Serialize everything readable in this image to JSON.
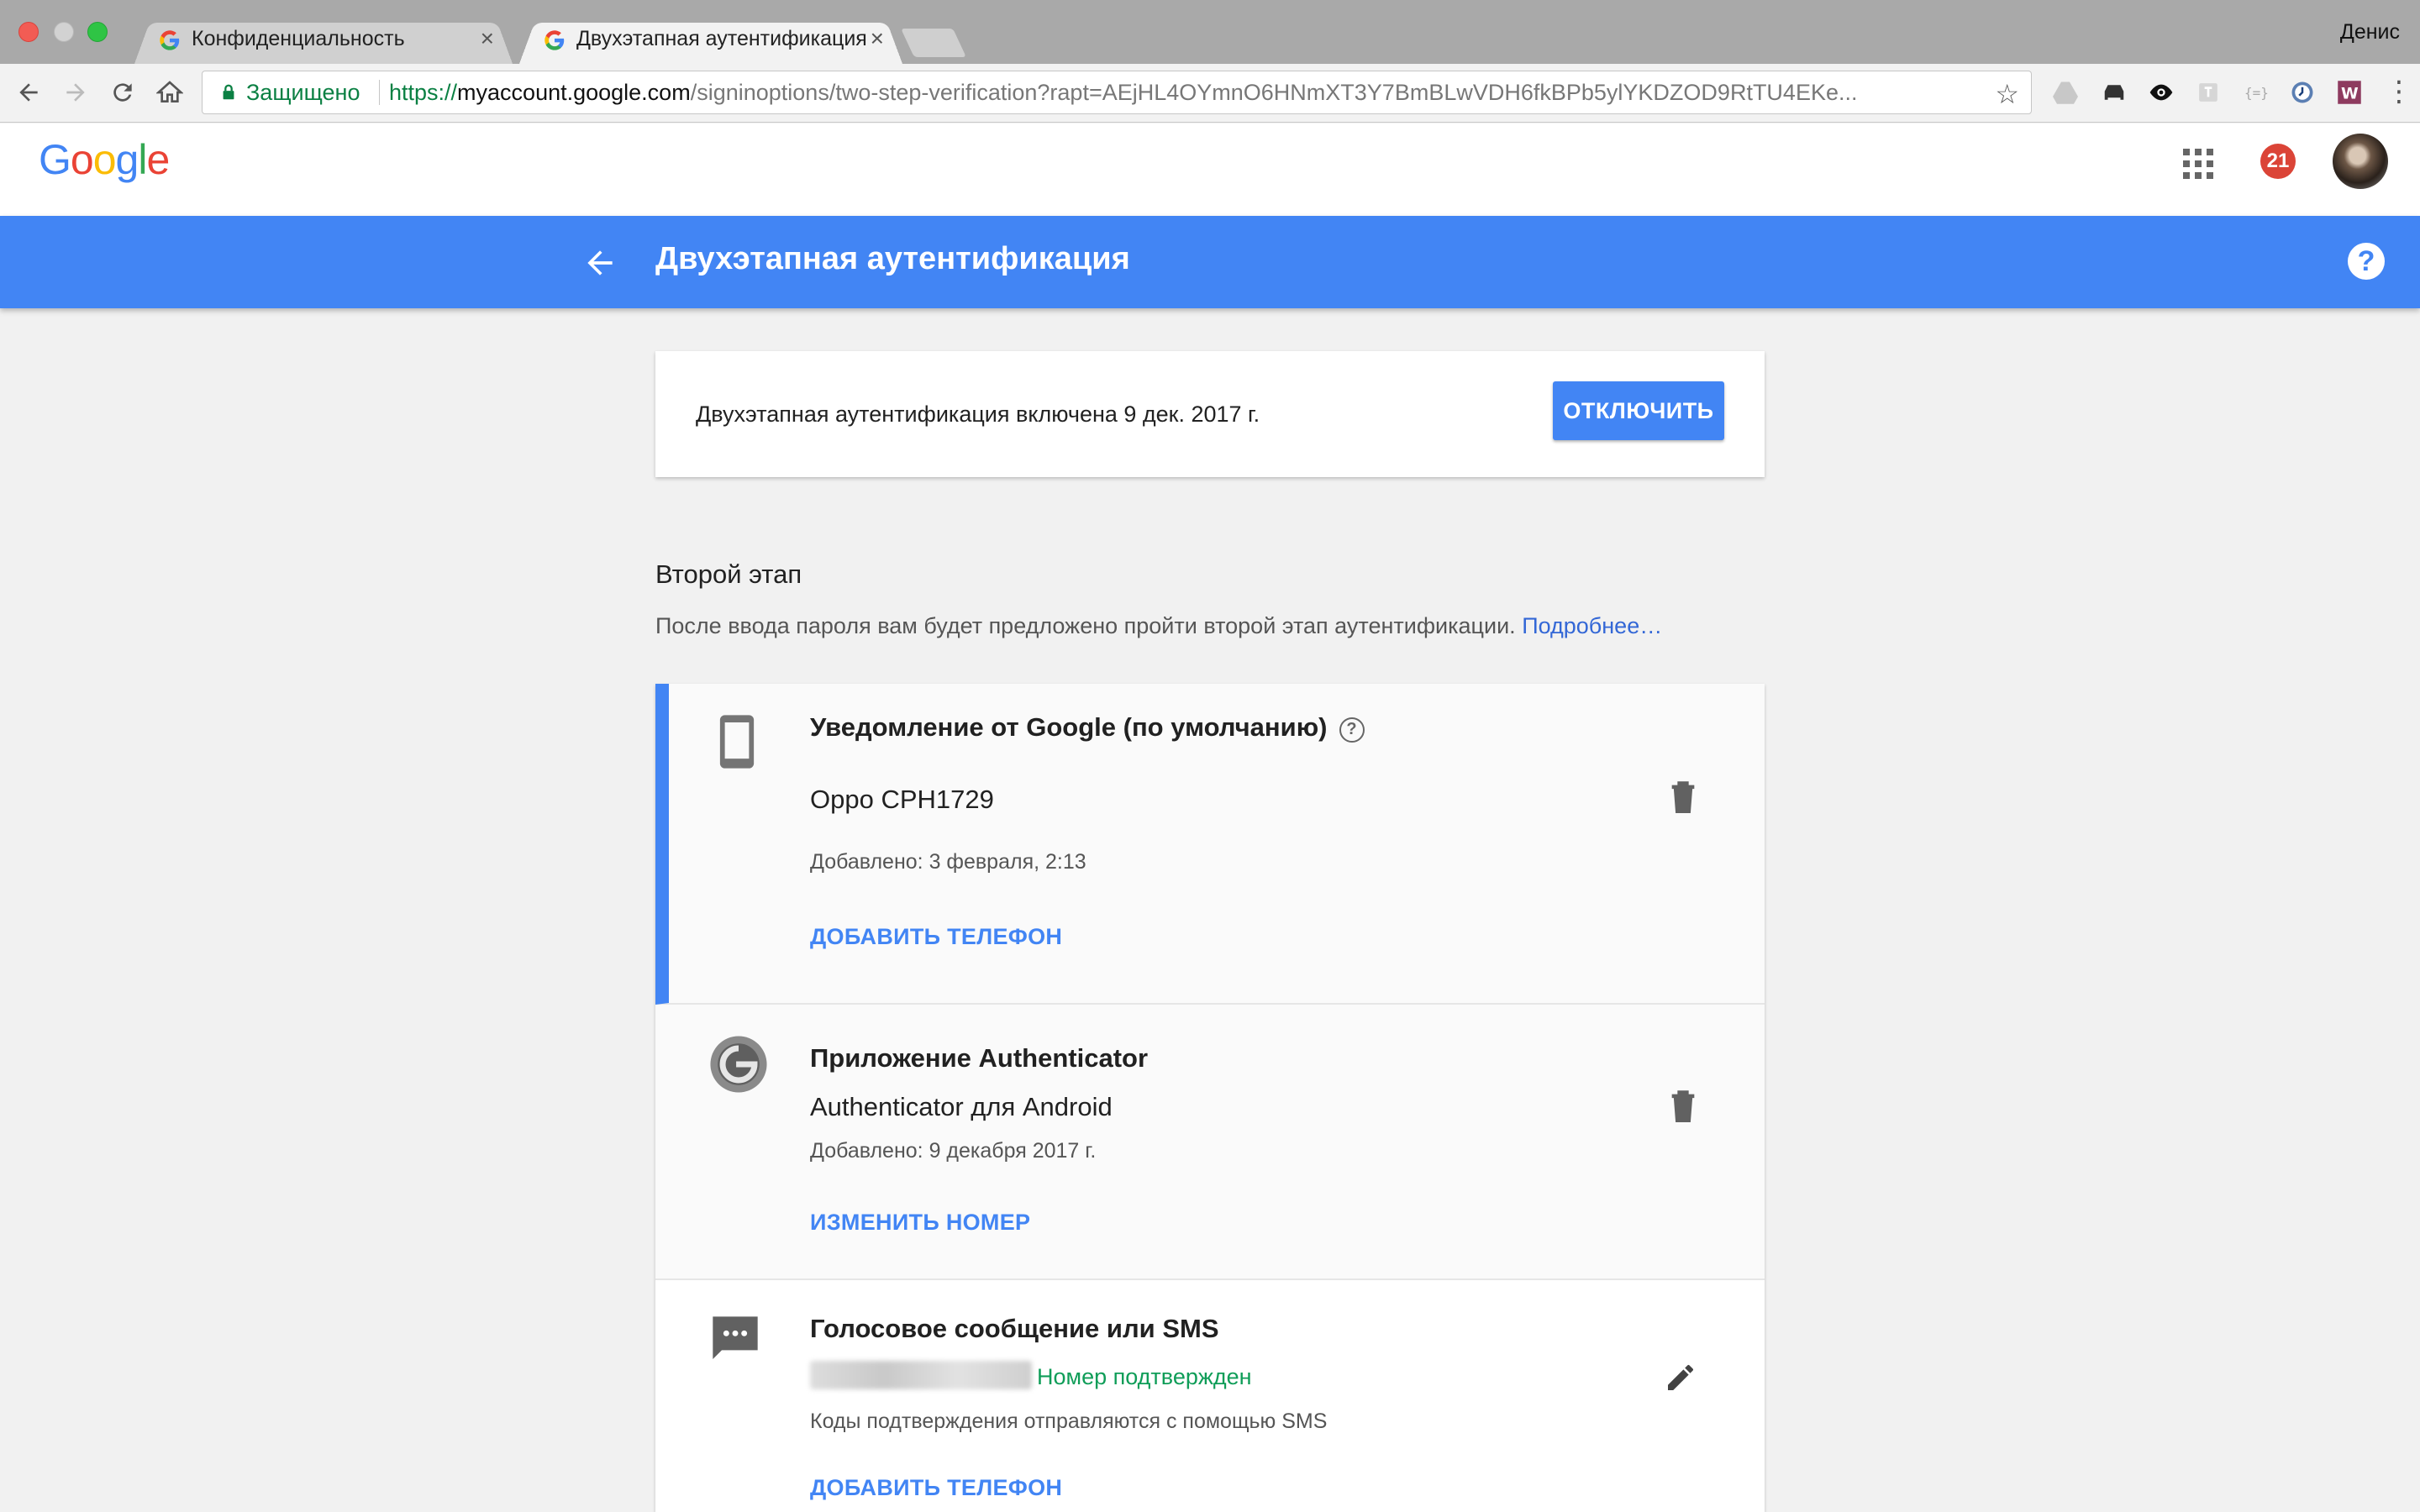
{
  "browser": {
    "tabs": [
      {
        "title": "Конфиденциальность",
        "active": false
      },
      {
        "title": "Двухэтапная аутентификация",
        "active": true
      }
    ],
    "profile_name": "Денис",
    "secure_label": "Защищено",
    "url": {
      "scheme": "https://",
      "host": "myaccount.google.com",
      "path": "/signinoptions/two-step-verification?rapt=AEjHL4OYmnO6HNmXT3Y7BmBLwVDH6fkBPb5ylYKDZOD9RtTU4EKe..."
    },
    "close_glyph": "×",
    "star_glyph": "☆",
    "menu_glyph": "⋮"
  },
  "header": {
    "logo_letters": [
      "G",
      "o",
      "o",
      "g",
      "l",
      "e"
    ],
    "logo_colors": [
      "#4285f4",
      "#ea4335",
      "#fbbc05",
      "#4285f4",
      "#34a853",
      "#ea4335"
    ],
    "notifications_count": "21"
  },
  "bluebar": {
    "title": "Двухэтапная аутентификация",
    "help_glyph": "?"
  },
  "status": {
    "text": "Двухэтапная аутентификация включена 9 дек. 2017 г.",
    "disable_button": "ОТКЛЮЧИТЬ"
  },
  "second_step": {
    "title": "Второй этап",
    "description": "После ввода пароля вам будет предложено пройти второй этап аутентификации.",
    "more_link": "Подробнее…"
  },
  "methods": [
    {
      "title": "Уведомление от Google (по умолчанию)",
      "help_glyph": "?",
      "device": "Oppo CPH1729",
      "added": "Добавлено: 3 февраля, 2:13",
      "action": "ДОБАВИТЬ ТЕЛЕФОН",
      "icon": "phone-icon"
    },
    {
      "title": "Приложение Authenticator",
      "device": "Authenticator для Android",
      "added": "Добавлено: 9 декабря 2017 г.",
      "action": "ИЗМЕНИТЬ НОМЕР",
      "icon": "authenticator-icon"
    },
    {
      "title": "Голосовое сообщение или SMS",
      "verified": "Номер подтвержден",
      "note": "Коды подтверждения отправляются с помощью SMS",
      "action": "ДОБАВИТЬ ТЕЛЕФОН",
      "icon": "sms-icon"
    }
  ]
}
